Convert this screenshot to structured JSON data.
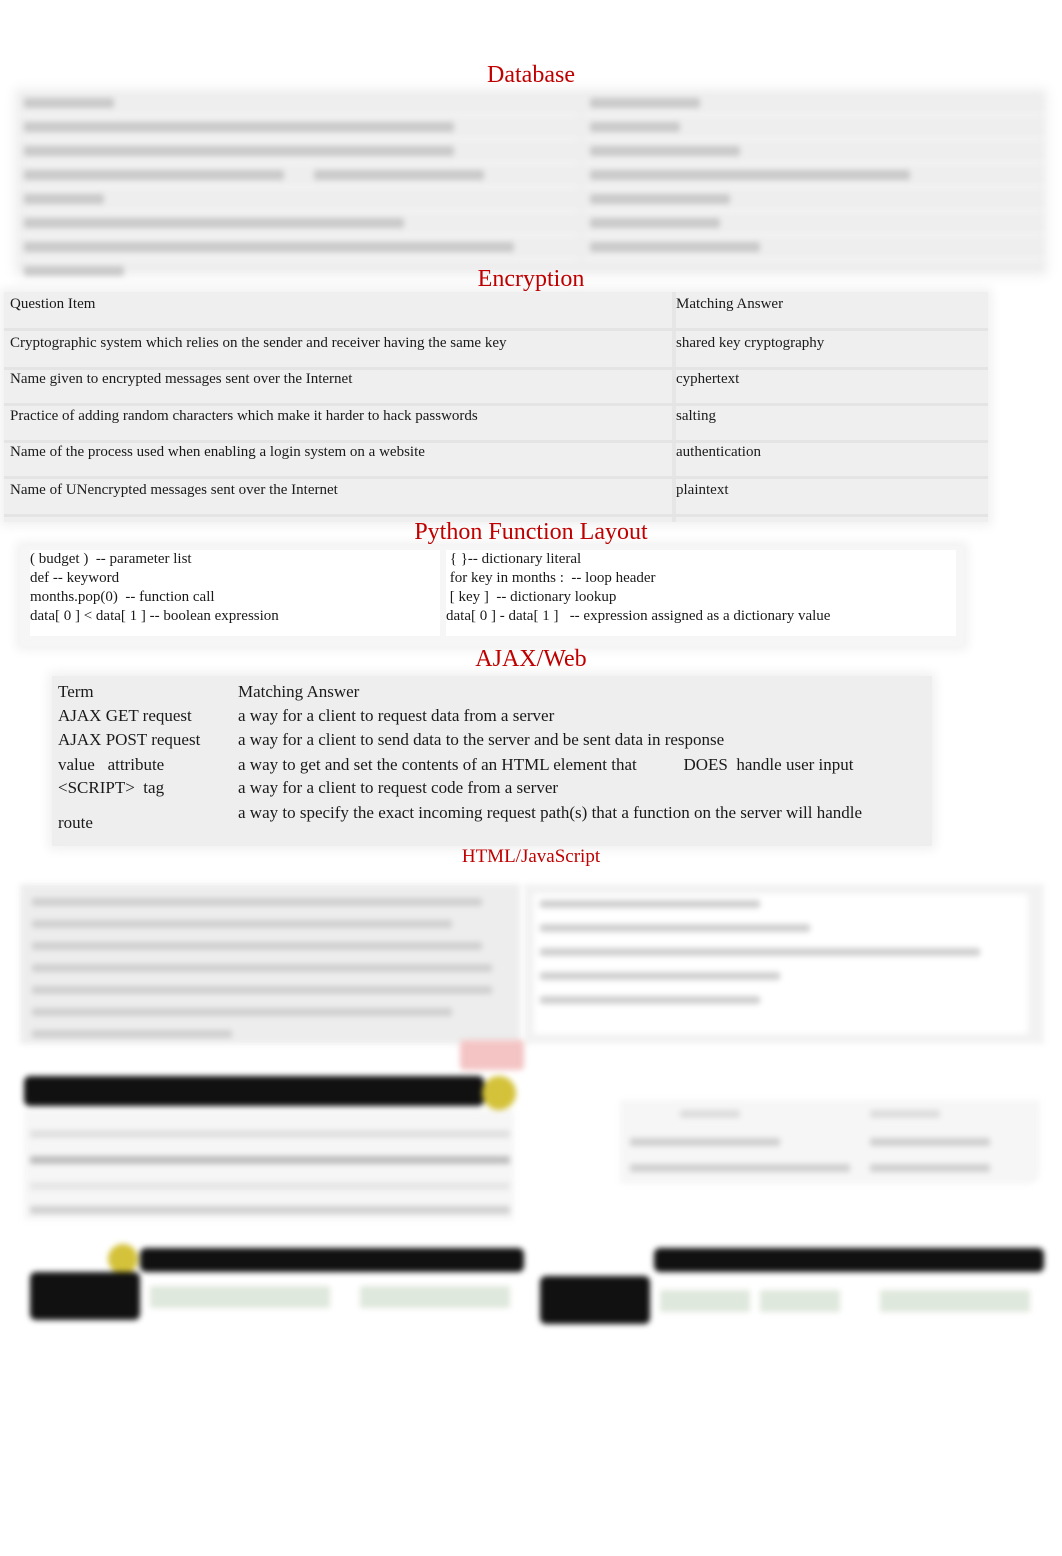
{
  "sections": {
    "database": {
      "title": "Database",
      "obscured": true
    },
    "encryption": {
      "title": "Encryption",
      "header": {
        "question": "Question Item",
        "answer": "Matching Answer"
      },
      "rows": [
        {
          "question": "Cryptographic system which relies on the sender and receiver having the same key",
          "answer": "shared key cryptography"
        },
        {
          "question": "Name given to encrypted  messages sent over the Internet",
          "answer": "cyphertext"
        },
        {
          "question": "Practice of adding random characters which make it harder to hack passwords",
          "answer": "salting"
        },
        {
          "question": "Name of the process used when enabling a login system on a website",
          "answer": "authentication"
        },
        {
          "question": "Name of UNencrypted messages sent over the Internet",
          "answer": "plaintext"
        }
      ]
    },
    "python": {
      "title": "Python Function Layout",
      "left": [
        "( budget )  -- parameter list",
        "def -- keyword",
        "months.pop(0)  -- function call",
        "data[ 0 ] < data[ 1 ] -- boolean expression"
      ],
      "right": [
        " { }-- dictionary literal",
        " for key in months :  -- loop header",
        " [ key ]  -- dictionary lookup",
        "data[ 0 ] - data[ 1 ]   -- expression assigned as a dictionary value"
      ]
    },
    "ajax": {
      "title": "AJAX/Web",
      "header": {
        "term": "Term",
        "answer": "Matching Answer"
      },
      "rows": [
        {
          "term": "AJAX GET request",
          "answer": "a way for a client to request data from a server"
        },
        {
          "term": "AJAX POST request",
          "answer": "a way for a client to send data to the server and be sent data in response"
        },
        {
          "term": "value   attribute",
          "answer": "a way to get and set the contents of an HTML element that           DOES  handle user input"
        },
        {
          "term": "<SCRIPT>  tag",
          "answer": "a way for a client to request code from a server"
        },
        {
          "term": "route",
          "answer": "a way to specify the exact incoming request path(s) that a function on the server will handle"
        }
      ]
    },
    "html_js": {
      "title": "HTML/JavaScript",
      "obscured": true
    },
    "tools": {
      "obscured": true
    }
  },
  "colors": {
    "heading": "#c00000",
    "text": "#1a1a1a"
  }
}
